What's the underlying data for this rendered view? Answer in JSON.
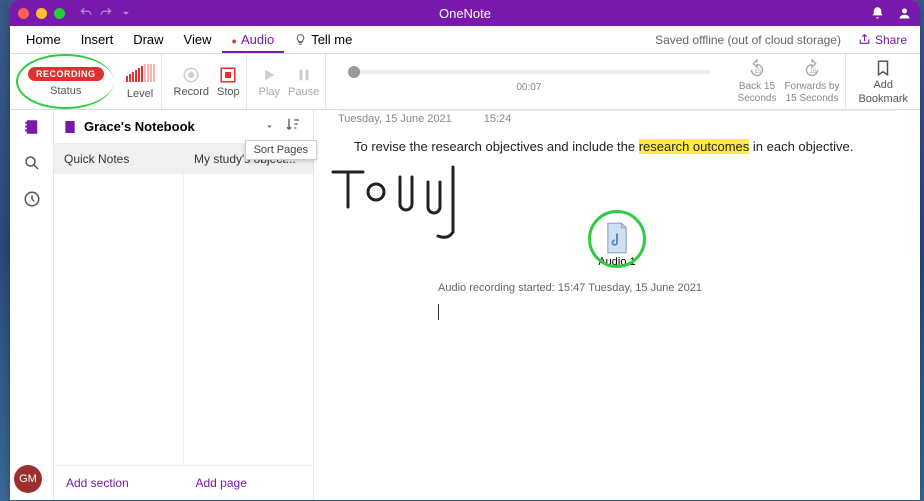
{
  "app": {
    "title": "OneNote"
  },
  "menu": {
    "home": "Home",
    "insert": "Insert",
    "draw": "Draw",
    "view": "View",
    "audio": "Audio",
    "tellme": "Tell me",
    "saved": "Saved offline (out of cloud storage)",
    "share": "Share"
  },
  "ribbon": {
    "recording": "RECORDING",
    "status": "Status",
    "level": "Level",
    "record": "Record",
    "stop": "Stop",
    "play": "Play",
    "pause": "Pause",
    "time": "00:07",
    "back": "Back 15",
    "forward": "Forwards by",
    "seconds": "Seconds",
    "seconds2": "15 Seconds",
    "addbm": "Add",
    "bookmark": "Bookmark"
  },
  "nav": {
    "notebook": "Grace's Notebook",
    "sort_tooltip": "Sort Pages",
    "sections": [
      "Quick Notes"
    ],
    "pages": [
      "My study's object..."
    ],
    "add_section": "Add section",
    "add_page": "Add page"
  },
  "page": {
    "date": "Tuesday, 15 June 2021",
    "time": "15:24",
    "text_pre": "To revise the research objectives and include the ",
    "text_hl": "research outcomes",
    "text_post": " in each objective.",
    "audio_name": "Audio 1",
    "rec_note": "Audio recording started: 15:47 Tuesday, 15 June 2021"
  },
  "user": {
    "initials": "GM"
  }
}
